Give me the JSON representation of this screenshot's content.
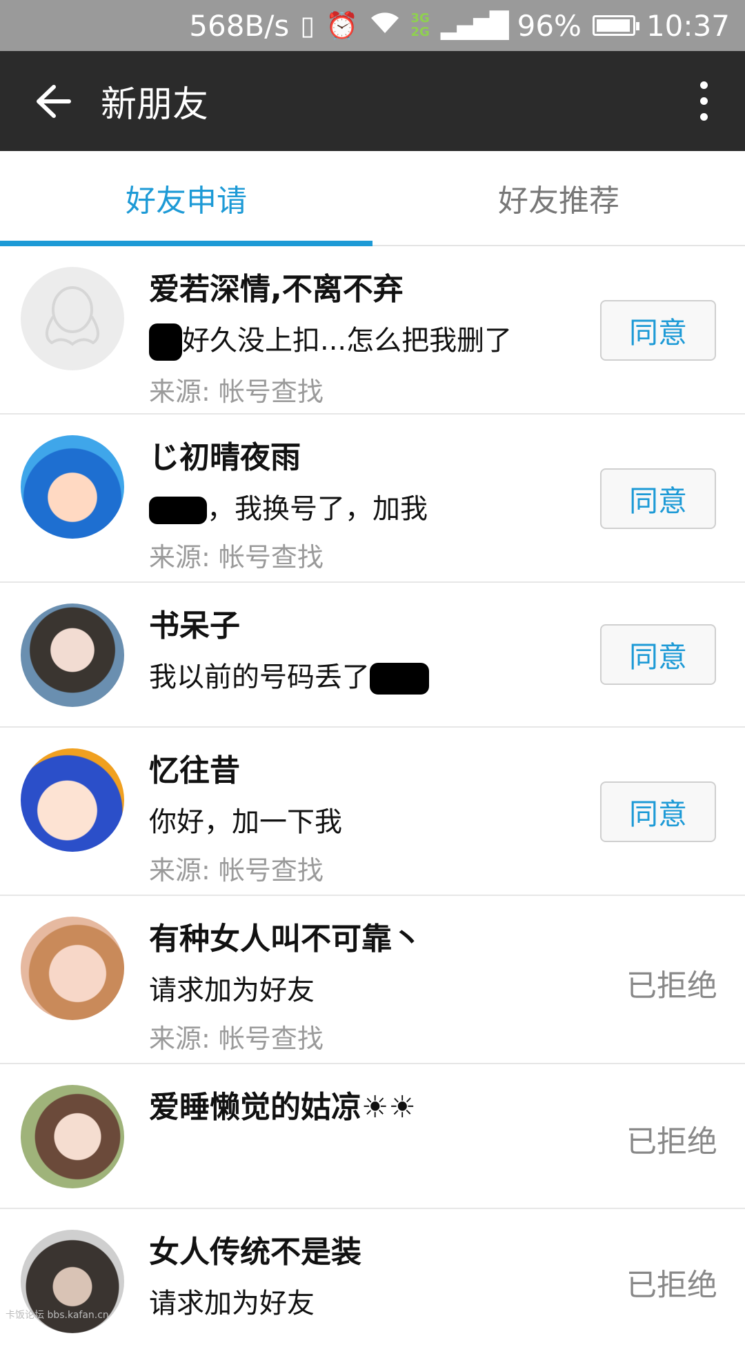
{
  "status": {
    "net_speed": "568B/s",
    "net_3g": "3G",
    "net_2g": "2G",
    "battery": "96%",
    "battery_level": 0.96,
    "time": "10:37"
  },
  "appbar": {
    "title": "新朋友"
  },
  "tabs": [
    {
      "label": "好友申请",
      "active": true
    },
    {
      "label": "好友推荐",
      "active": false
    }
  ],
  "requests": [
    {
      "name": "爱若深情,不离不弃",
      "message": "好久没上扣...怎么把我删了",
      "source": "来源: 帐号查找",
      "action": "同意"
    },
    {
      "name": "じ初晴夜雨",
      "message": "，我换号了，加我",
      "source": "来源: 帐号查找",
      "action": "同意"
    },
    {
      "name": "书呆子",
      "message": "我以前的号码丢了",
      "source": "",
      "action": "同意"
    },
    {
      "name": "忆往昔",
      "message": "你好，加一下我",
      "source": "来源: 帐号查找",
      "action": "同意"
    },
    {
      "name": "有种女人叫不可靠丶",
      "message": "请求加为好友",
      "source": "来源: 帐号查找",
      "action": "已拒绝"
    },
    {
      "name": "爱睡懒觉的姑凉☀☀",
      "message": "",
      "source": "",
      "action": "已拒绝"
    },
    {
      "name": "女人传统不是装",
      "message": "请求加为好友",
      "source": "",
      "action": "已拒绝"
    }
  ],
  "watermark": "卡饭论坛 bbs.kafan.cn",
  "colors": {
    "accent": "#1d9ad6",
    "appbar": "#2b2b2b",
    "statusbar": "#9a9a9a"
  }
}
